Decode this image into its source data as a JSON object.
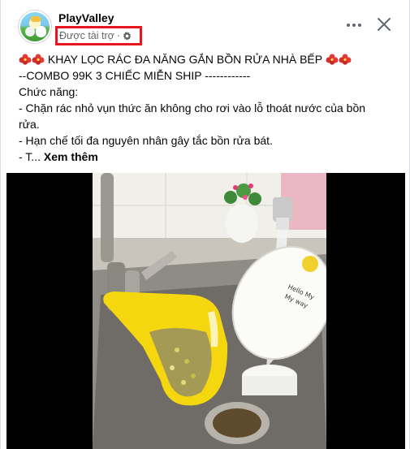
{
  "post": {
    "page_name": "PlayValley",
    "sponsored_label": "Được tài trợ",
    "separator": "·",
    "more_icon": "ellipsis-icon",
    "close_icon": "close-icon",
    "text_lines": [
      "KHAY LỌC RÁC ĐA NĂNG GẮN BỒN RỬA NHÀ BẾP",
      "--COMBO 99K 3 CHIẾC MIỄN SHIP ------------",
      "Chức năng:",
      "- Chặn rác nhỏ vụn thức ăn không cho rơi vào lỗ thoát nước của bồn",
      "rửa.",
      "- Hạn chế tối đa nguyên nhân gây tắc bồn rửa bát.",
      "- T..."
    ],
    "see_more": "Xem thêm"
  },
  "video": {
    "plate_text_line1": "Hello My",
    "plate_text_line2": "My way"
  },
  "colors": {
    "highlight_box": "#e8161f",
    "secondary_text": "#65676b",
    "tray_yellow": "#f5d70f"
  }
}
